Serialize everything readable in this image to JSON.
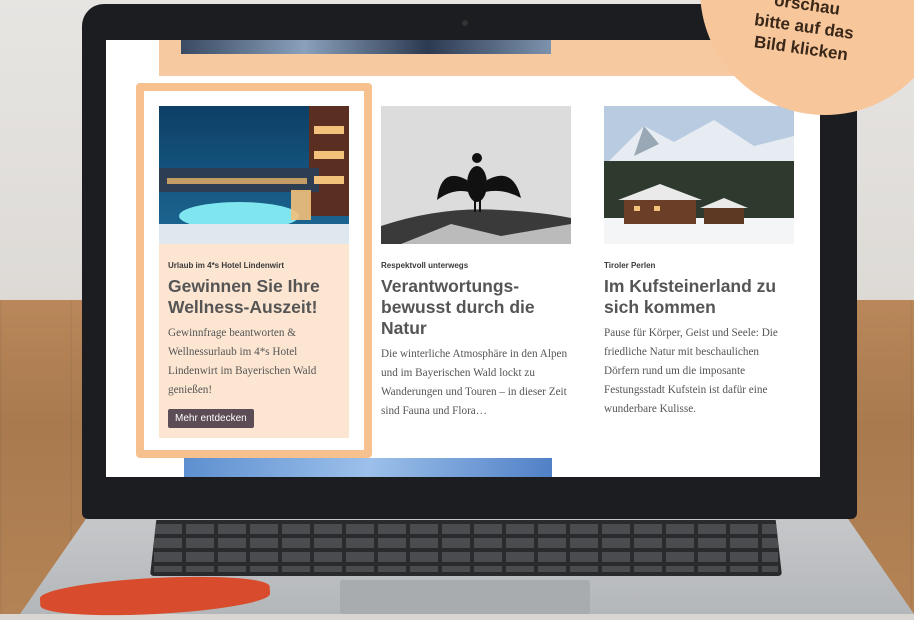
{
  "badge": {
    "line1": "orschau",
    "line2": "bitte auf das",
    "line3": "Bild klicken"
  },
  "sticker": {
    "text": ""
  },
  "cards": [
    {
      "kicker": "Urlaub im 4*s Hotel Lindenwirt",
      "title": "Gewinnen Sie Ihre Wellness-Auszeit!",
      "description": "Gewinnfrage beantworten & Wellnessurlaub im 4*s Hotel Lindenwirt im Bayerischen Wald genießen!",
      "button": "Mehr entdecken"
    },
    {
      "kicker": "Respektvoll unterwegs",
      "title": "Verantwortungs-bewusst durch die Natur",
      "description": "Die winterliche Atmosphäre in den Alpen und im Bayerischen Wald lockt zu Wanderungen und Touren – in dieser Zeit sind Fauna und Flora…"
    },
    {
      "kicker": "Tiroler Perlen",
      "title": "Im Kufsteinerland zu sich kommen",
      "description": "Pause für Körper, Geist und Seele: Die friedliche Natur mit beschaulichen Dörfern rund um die imposante Festungsstadt Kufstein ist dafür eine wunderbare Kulisse."
    }
  ],
  "colors": {
    "accent": "#f6c08f",
    "featured_bg": "#fce6d2",
    "button_bg": "#5c4c55"
  }
}
